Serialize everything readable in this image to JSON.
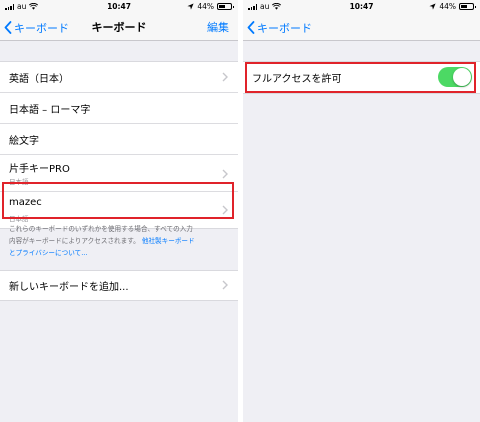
{
  "left": {
    "status": {
      "carrier": "au",
      "time": "10:47",
      "battery": "44%",
      "battery_level": 0.44
    },
    "nav": {
      "back_label": "キーボード",
      "title": "キーボード",
      "action_label": "編集"
    },
    "keyboards": [
      {
        "label": "英語（日本）",
        "sub": "",
        "chevron": true
      },
      {
        "label": "日本語 – ローマ字",
        "sub": "",
        "chevron": false
      },
      {
        "label": "絵文字",
        "sub": "",
        "chevron": false
      },
      {
        "label": "片手キーPRO",
        "sub": "日本語",
        "chevron": true
      },
      {
        "label": "mazec",
        "sub": "日本語",
        "chevron": true
      }
    ],
    "footnote": {
      "text_line1": "これらのキーボードのいずれかを使用する場合、すべての入力",
      "text_line2": "内容がキーボードによりアクセスされます。",
      "link_part1": "他社製キーボード",
      "link_part2": "とプライバシーについて..."
    },
    "add_keyboard_label": "新しいキーボードを追加..."
  },
  "right": {
    "status": {
      "carrier": "au",
      "time": "10:47",
      "battery": "44%",
      "battery_level": 0.44
    },
    "nav": {
      "back_label": "キーボード"
    },
    "full_access": {
      "label": "フルアクセスを許可",
      "enabled": true
    }
  },
  "colors": {
    "accent": "#007aff",
    "toggle_on": "#4cd964",
    "highlight": "#e0232a",
    "background": "#efeff4"
  }
}
